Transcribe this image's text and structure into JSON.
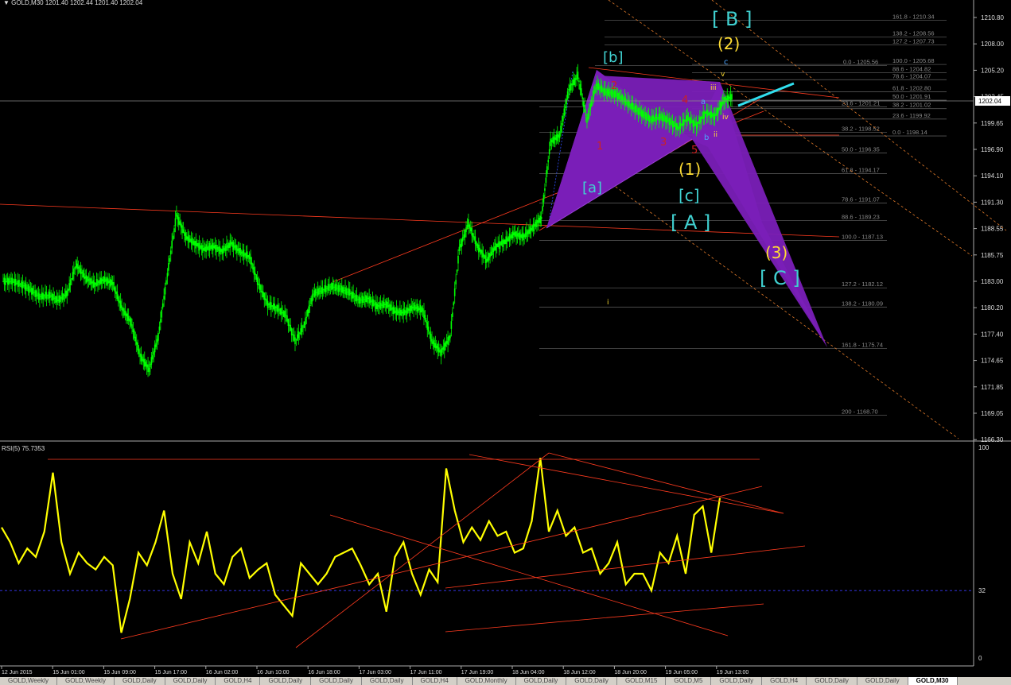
{
  "header": {
    "symbol": "GOLD,M30",
    "open": "1201.40",
    "high": "1202.44",
    "low": "1201.40",
    "close": "1202.04"
  },
  "rsi_header": "RSI(5) 75.7353",
  "current_price": "1202.04",
  "price_ticks": [
    "1210.80",
    "1208.00",
    "1205.20",
    "1202.45",
    "1199.65",
    "1196.90",
    "1194.10",
    "1191.30",
    "1188.55",
    "1185.75",
    "1183.00",
    "1180.20",
    "1177.40",
    "1174.65",
    "1171.85",
    "1169.05",
    "1166.30"
  ],
  "rsi_ticks": [
    "100",
    "32",
    "0"
  ],
  "time_labels": [
    "12 Jun 2015",
    "15 Jun 01:00",
    "15 Jun 09:00",
    "15 Jun 17:00",
    "16 Jun 02:00",
    "16 Jun 10:00",
    "16 Jun 18:00",
    "17 Jun 03:00",
    "17 Jun 11:00",
    "17 Jun 19:00",
    "18 Jun 04:00",
    "18 Jun 12:00",
    "18 Jun 20:00",
    "19 Jun 05:00",
    "19 Jun 13:00"
  ],
  "fibs": [
    {
      "label": "161.8 - 1210.34",
      "price": 1210.34
    },
    {
      "label": "138.2 - 1208.56",
      "price": 1208.56
    },
    {
      "label": "127.2 - 1207.73",
      "price": 1207.73
    },
    {
      "label": "0.0 - 1205.56",
      "price": 1205.56
    },
    {
      "label": "100.0 - 1205.68",
      "price": 1205.68
    },
    {
      "label": "88.6 - 1204.82",
      "price": 1204.82
    },
    {
      "label": "78.6 - 1204.07",
      "price": 1204.07
    },
    {
      "label": "61.8 - 1202.80",
      "price": 1202.8
    },
    {
      "label": "50.0 - 1201.91",
      "price": 1201.91
    },
    {
      "label": "38.2 - 1201.02",
      "price": 1201.02
    },
    {
      "label": "23.6 - 1201.21",
      "price": 1201.21
    },
    {
      "label": "23.6 - 1199.92",
      "price": 1199.92
    },
    {
      "label": "38.2 - 1198.52",
      "price": 1198.52
    },
    {
      "label": "0.0 - 1198.14",
      "price": 1198.14
    },
    {
      "label": "50.0 - 1196.35",
      "price": 1196.35
    },
    {
      "label": "61.8 - 1194.17",
      "price": 1194.17
    },
    {
      "label": "78.6 - 1191.07",
      "price": 1191.07
    },
    {
      "label": "88.6 - 1189.23",
      "price": 1189.23
    },
    {
      "label": "100.0 - 1187.13",
      "price": 1187.13
    },
    {
      "label": "127.2 - 1182.12",
      "price": 1182.12
    },
    {
      "label": "138.2 - 1180.09",
      "price": 1180.09
    },
    {
      "label": "161.8 - 1175.74",
      "price": 1175.74
    },
    {
      "label": "200 - 1168.70",
      "price": 1168.7
    }
  ],
  "wave_labels": {
    "B_big": "[ B ]",
    "w2": "(2)",
    "b_sq": "[b]",
    "w1": "(1)",
    "c_sq": "[c]",
    "A_big": "[ A ]",
    "a_sq": "[a]",
    "w3": "(3)",
    "C_big": "[ C ]",
    "n1": "1",
    "n2": "2",
    "n3": "3",
    "n4": "4",
    "n5": "5",
    "r_i": "i",
    "r_ii": "ii",
    "r_iii": "iii",
    "r_iv": "iv",
    "r_v": "v",
    "s_a": "a",
    "s_b": "b",
    "s_c": "c",
    "r_i_low": "i"
  },
  "tabs": [
    "GOLD,Weekly",
    "GOLD,Weekly",
    "GOLD,Daily",
    "GOLD,Daily",
    "GOLD,H4",
    "GOLD,Daily",
    "GOLD,Daily",
    "GOLD,Daily",
    "GOLD,H4",
    "GOLD,Monthly",
    "GOLD,Daily",
    "GOLD,Daily",
    "GOLD,M15",
    "GOLD,M5",
    "GOLD,Daily",
    "GOLD,H4",
    "GOLD,Daily",
    "GOLD,Daily",
    "GOLD,M30"
  ],
  "colors": {
    "candle": "#00ff00",
    "rsi": "#ffff00",
    "trend": "#ff3b1f",
    "pattern": "#7a1fb8",
    "fib": "#555555",
    "cyan": "#40d0d0",
    "yellow_label": "#ffdd33",
    "red_label": "#cc2222"
  },
  "chart_data": {
    "type": "line",
    "title": "GOLD,M30",
    "price_range": [
      1166.3,
      1212.0
    ],
    "series": [
      {
        "name": "GOLD,M30",
        "values": [
          1182.8,
          1182.5,
          1181.9,
          1181.2,
          1181.4,
          1180.8,
          1181.5,
          1184.6,
          1183.2,
          1182.5,
          1183.0,
          1182.6,
          1180.0,
          1178.5,
          1175.0,
          1173.5,
          1177.0,
          1183.5,
          1189.8,
          1187.5,
          1186.8,
          1186.2,
          1186.5,
          1186.0,
          1186.8,
          1185.9,
          1185.4,
          1182.5,
          1180.4,
          1180.0,
          1179.2,
          1176.5,
          1178.2,
          1181.5,
          1181.9,
          1182.3,
          1182.0,
          1181.6,
          1180.8,
          1181.0,
          1180.2,
          1180.4,
          1179.6,
          1179.5,
          1180.1,
          1179.8,
          1176.5,
          1175.3,
          1177.0,
          1186.2,
          1188.9,
          1186.5,
          1185.0,
          1186.5,
          1187.0,
          1187.8,
          1187.5,
          1188.4,
          1189.5,
          1197.5,
          1198.2,
          1203.0,
          1204.5,
          1199.8,
          1203.5,
          1202.8,
          1202.6,
          1202.0,
          1201.2,
          1200.5,
          1199.9,
          1200.2,
          1199.7,
          1199.0,
          1200.0,
          1199.2,
          1200.6,
          1200.2,
          1201.9,
          1202.3
        ]
      }
    ],
    "rsi": {
      "name": "RSI(5)",
      "last": 75.7353,
      "ylim": [
        0,
        100
      ],
      "level": 32,
      "values": [
        62,
        55,
        45,
        52,
        48,
        60,
        88,
        55,
        40,
        50,
        45,
        42,
        48,
        44,
        12,
        28,
        50,
        44,
        55,
        70,
        40,
        28,
        55,
        45,
        60,
        40,
        35,
        48,
        52,
        38,
        42,
        45,
        30,
        25,
        20,
        45,
        40,
        35,
        40,
        48,
        50,
        52,
        44,
        35,
        40,
        22,
        48,
        55,
        40,
        30,
        42,
        36,
        90,
        70,
        55,
        62,
        56,
        65,
        58,
        60,
        50,
        52,
        65,
        95,
        60,
        70,
        58,
        62,
        50,
        52,
        40,
        45,
        55,
        35,
        40,
        40,
        32,
        50,
        45,
        58,
        40,
        68,
        72,
        50,
        76
      ]
    }
  }
}
